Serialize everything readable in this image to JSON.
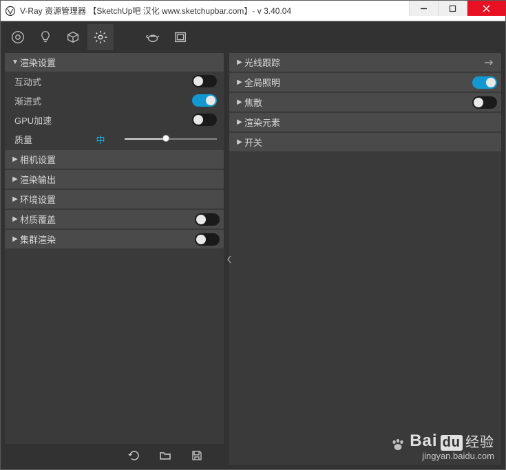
{
  "window": {
    "title": "V-Ray 资源管理器 【SketchUp吧 汉化 www.sketchupbar.com】- v 3.40.04"
  },
  "toolbar": {
    "icons": [
      "globe",
      "bulb",
      "cube",
      "gear",
      "teapot",
      "frame"
    ]
  },
  "left": {
    "render_settings": "渲染设置",
    "interactive_label": "互动式",
    "interactive_on": false,
    "progressive_label": "渐进式",
    "progressive_on": true,
    "gpu_label": "GPU加速",
    "gpu_on": false,
    "quality_label": "质量",
    "quality_value": "中",
    "quality_pos": 0.45,
    "camera": "相机设置",
    "output": "渲染输出",
    "env": "环境设置",
    "mat_override": "材质覆盖",
    "mat_override_on": false,
    "swarm": "集群渲染",
    "swarm_on": false
  },
  "right": {
    "ray": "光线跟踪",
    "gi": "全局照明",
    "gi_on": true,
    "caustics": "焦散",
    "caustics_on": false,
    "elements": "渲染元素",
    "switches": "开关"
  },
  "watermark": {
    "brand1": "Bai",
    "brand2": "du",
    "brand3": "经验",
    "url": "jingyan.baidu.com"
  }
}
